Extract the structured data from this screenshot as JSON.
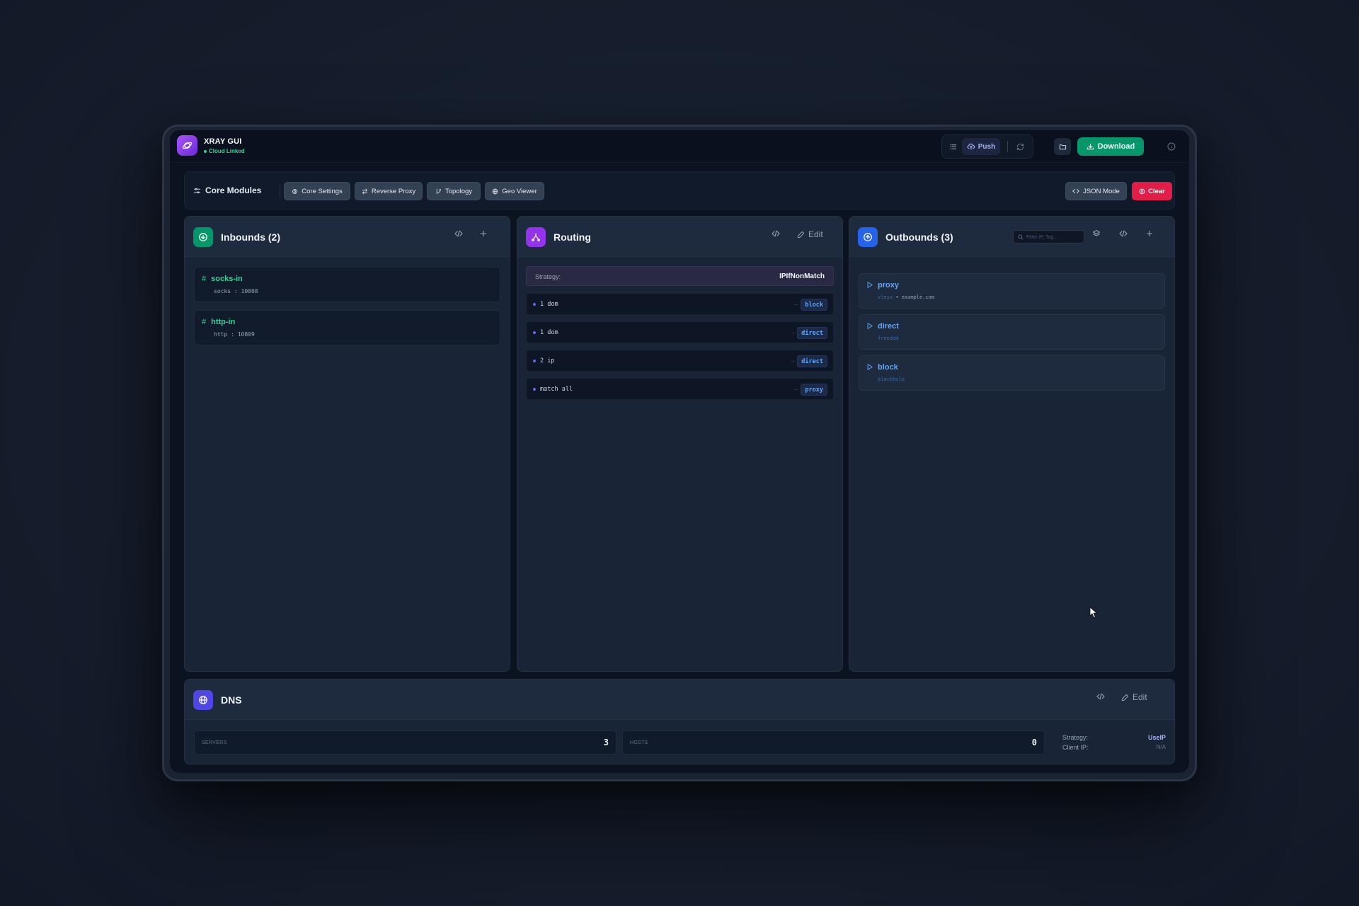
{
  "app": {
    "title": "XRAY GUI",
    "status": "Cloud Linked"
  },
  "topbar": {
    "push_label": "Push",
    "download_label": "Download",
    "icons": [
      "list-icon",
      "cloud-upload-icon",
      "refresh-icon",
      "folder-icon",
      "download-icon",
      "info-icon"
    ]
  },
  "modules": {
    "title": "Core Modules",
    "buttons": [
      {
        "label": "Core Settings",
        "icon": "gear-icon"
      },
      {
        "label": "Reverse Proxy",
        "icon": "arrows-icon"
      },
      {
        "label": "Topology",
        "icon": "git-branch-icon"
      },
      {
        "label": "Geo Viewer",
        "icon": "globe-icon"
      }
    ],
    "json_mode_label": "JSON Mode",
    "clear_label": "Clear"
  },
  "inbounds": {
    "title": "Inbounds (2)",
    "items": [
      {
        "tag": "socks-in",
        "detail": "socks : 10808"
      },
      {
        "tag": "http-in",
        "detail": "http : 10809"
      }
    ]
  },
  "routing": {
    "title": "Routing",
    "edit_label": "Edit",
    "strategy_label": "Strategy:",
    "strategy_value": "IPIfNonMatch",
    "rules": [
      {
        "text": "1 dom",
        "target": "block"
      },
      {
        "text": "1 dom",
        "target": "direct"
      },
      {
        "text": "2 ip",
        "target": "direct"
      },
      {
        "text": "match all",
        "target": "proxy"
      }
    ]
  },
  "outbounds": {
    "title": "Outbounds (3)",
    "filter_placeholder": "Filter IP, Tag...",
    "items": [
      {
        "tag": "proxy",
        "protocol": "vless",
        "host": "example.com"
      },
      {
        "tag": "direct",
        "protocol": "freedom",
        "host": ""
      },
      {
        "tag": "block",
        "protocol": "blackhole",
        "host": ""
      }
    ]
  },
  "dns": {
    "title": "DNS",
    "edit_label": "Edit",
    "servers_label": "SERVERS",
    "servers_value": "3",
    "hosts_label": "HOSTS",
    "hosts_value": "0",
    "strategy_label": "Strategy:",
    "strategy_value": "UseIP",
    "client_ip_label": "Client IP:",
    "client_ip_value": "N/A"
  },
  "colors": {
    "accent_green": "#059669",
    "accent_purple": "#9333ea",
    "accent_blue": "#2563eb",
    "accent_indigo": "#4f46e5",
    "danger": "#e11d48",
    "link_blue": "#60a5fa",
    "tag_green": "#34d399"
  }
}
